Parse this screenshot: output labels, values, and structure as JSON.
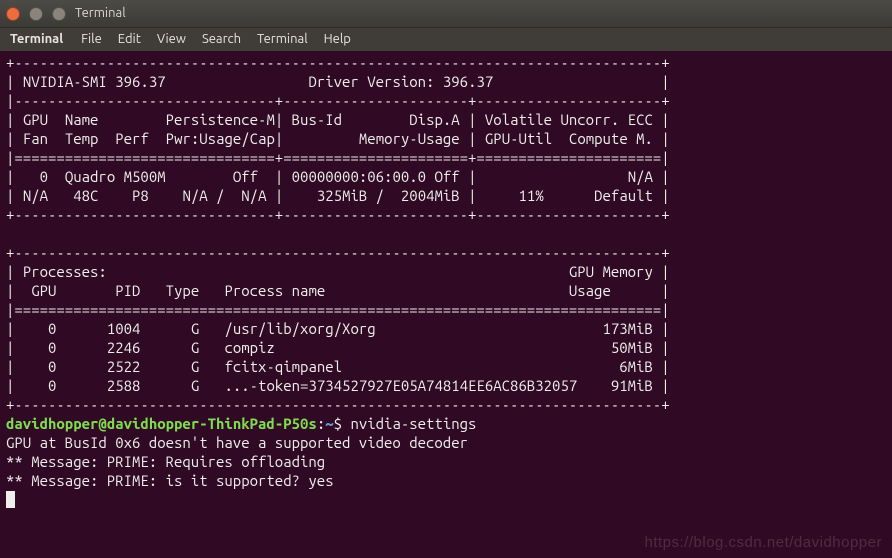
{
  "window": {
    "app_title": "Terminal",
    "menu": [
      "File",
      "Edit",
      "View",
      "Search",
      "Terminal",
      "Help"
    ]
  },
  "nvidia_smi": {
    "smi_version": "396.37",
    "driver_version": "396.37",
    "header_labels": {
      "smi_prefix": "NVIDIA-SMI",
      "driver_prefix": "Driver Version:",
      "gpu": "GPU",
      "name": "Name",
      "persistence": "Persistence-M",
      "bus_id": "Bus-Id",
      "disp_a": "Disp.A",
      "volatile": "Volatile",
      "uncorr_ecc": "Uncorr. ECC",
      "fan": "Fan",
      "temp": "Temp",
      "perf": "Perf",
      "pwr": "Pwr:Usage/Cap",
      "memory_usage": "Memory-Usage",
      "gpu_util": "GPU-Util",
      "compute_m": "Compute M."
    },
    "gpu_rows": [
      {
        "index": "0",
        "name": "Quadro M500M",
        "persistence": "Off",
        "bus_id": "00000000:06:00.0",
        "disp_a": "Off",
        "ecc": "N/A",
        "fan": "N/A",
        "temp": "48C",
        "perf": "P8",
        "pwr_usage": "N/A",
        "pwr_cap": "N/A",
        "mem_used": "325MiB",
        "mem_total": "2004MiB",
        "gpu_util": "11%",
        "compute_m": "Default"
      }
    ],
    "process_header": {
      "title": "Processes:",
      "gpu": "GPU",
      "pid": "PID",
      "type": "Type",
      "process_name": "Process name",
      "gpu_memory": "GPU Memory",
      "usage": "Usage"
    },
    "processes": [
      {
        "gpu": "0",
        "pid": "1004",
        "type": "G",
        "name": "/usr/lib/xorg/Xorg",
        "mem": "173MiB"
      },
      {
        "gpu": "0",
        "pid": "2246",
        "type": "G",
        "name": "compiz",
        "mem": "50MiB"
      },
      {
        "gpu": "0",
        "pid": "2522",
        "type": "G",
        "name": "fcitx-qimpanel",
        "mem": "6MiB"
      },
      {
        "gpu": "0",
        "pid": "2588",
        "type": "G",
        "name": "...-token=3734527927E05A74814EE6AC86B32057",
        "mem": "91MiB"
      }
    ]
  },
  "prompt": {
    "user": "davidhopper",
    "host": "davidhopper-ThinkPad-P50s",
    "path": "~",
    "command": "nvidia-settings"
  },
  "output_lines": [
    "GPU at BusId 0x6 doesn't have a supported video decoder",
    "** Message: PRIME: Requires offloading",
    "** Message: PRIME: is it supported? yes"
  ],
  "watermark": "https://blog.csdn.net/davidhopper"
}
